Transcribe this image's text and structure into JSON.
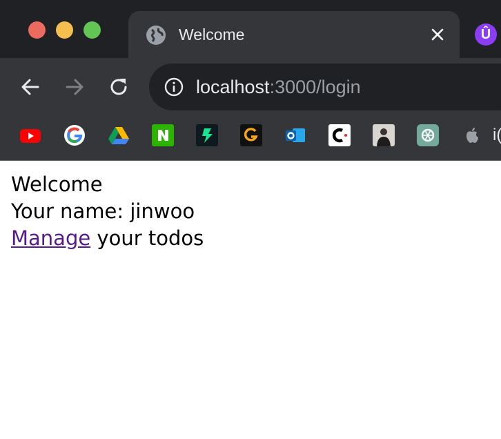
{
  "browser": {
    "tab_title": "Welcome",
    "url_host": "localhost",
    "url_rest": ":3000/login",
    "bookmark_overflow_text": "i("
  },
  "page": {
    "heading": "Welcome",
    "name_line": "Your name: jinwoo",
    "link_text": "Manage",
    "link_suffix": " your todos"
  },
  "icons": {
    "bookmarks": [
      "youtube-icon",
      "google-icon",
      "google-drive-icon",
      "naver-icon",
      "zeplin-icon",
      "g-icon",
      "outlook-icon",
      "c-icon",
      "profile-photo-icon",
      "chatgpt-icon",
      "apple-icon"
    ]
  }
}
